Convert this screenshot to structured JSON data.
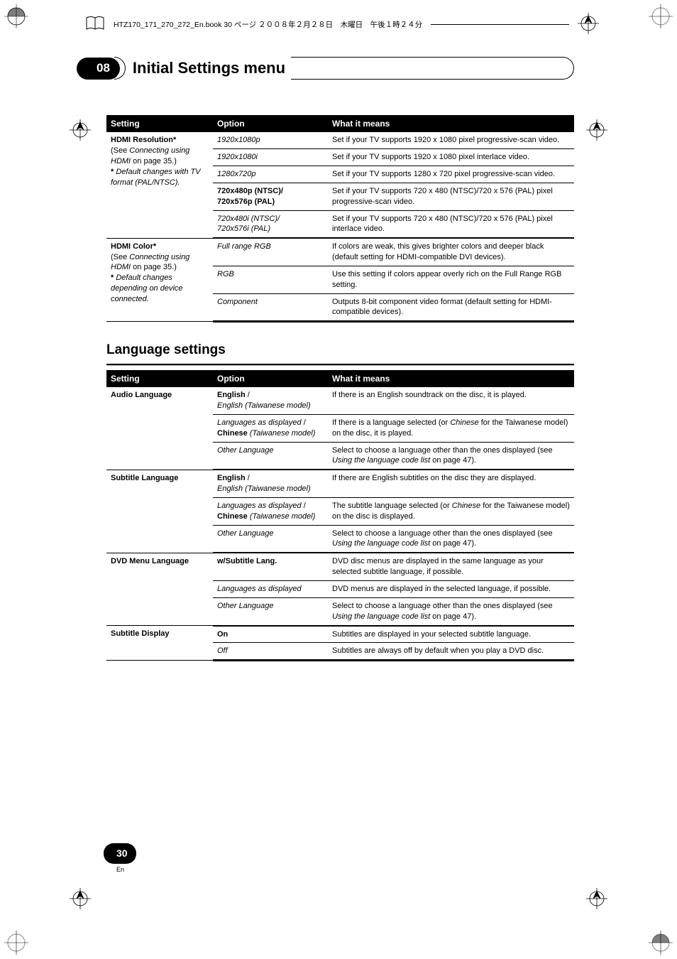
{
  "printerLine": "HTZ170_171_270_272_En.book  30 ページ  ２００８年２月２８日　木曜日　午後１時２４分",
  "chapter": {
    "number": "08",
    "title": "Initial Settings menu"
  },
  "table1": {
    "headers": [
      "Setting",
      "Option",
      "What it means"
    ],
    "groups": [
      {
        "setting_html": "<span class='bold'>HDMI Resolution*</span><br>(See <span class='ital'>Connecting using HDMI</span> on page 35.)<br><span class='bold'>*</span> <span class='ital'>Default changes with TV format (PAL/NTSC).</span>",
        "rows": [
          {
            "option_html": "<span class='ital'>1920x1080p</span>",
            "meaning": "Set if your TV supports 1920 x 1080 pixel progressive-scan video."
          },
          {
            "option_html": "<span class='ital'>1920x1080i</span>",
            "meaning": "Set if your TV supports 1920 x 1080 pixel interlace video."
          },
          {
            "option_html": "<span class='ital'>1280x720p</span>",
            "meaning": "Set if your TV supports 1280 x 720 pixel progressive-scan video."
          },
          {
            "option_html": "<span class='bold'>720x480p (NTSC)/<br>720x576p (PAL)</span>",
            "meaning": "Set if your TV supports 720 x 480 (NTSC)/720 x 576 (PAL) pixel progressive-scan video."
          },
          {
            "option_html": "<span class='ital'>720x480i (NTSC)/<br>720x576i (PAL)</span>",
            "meaning": "Set if your TV supports 720 x 480 (NTSC)/720 x 576 (PAL) pixel interlace video."
          }
        ]
      },
      {
        "setting_html": "<span class='bold'>HDMI Color*</span><br>(See <span class='ital'>Connecting using HDMI</span> on page 35.)<br><span class='bold'>*</span> <span class='ital'>Default changes depending on device connected.</span>",
        "rows": [
          {
            "option_html": "<span class='ital'>Full range RGB</span>",
            "meaning": "If colors are weak, this gives brighter colors and deeper black (default setting for HDMI-compatible DVI devices)."
          },
          {
            "option_html": "<span class='ital'>RGB</span>",
            "meaning": "Use this setting if colors appear overly rich on the Full Range RGB setting."
          },
          {
            "option_html": "<span class='ital'>Component</span>",
            "meaning": "Outputs 8-bit component video format (default setting for HDMI-compatible devices)."
          }
        ]
      }
    ]
  },
  "section2Title": "Language settings",
  "table2": {
    "headers": [
      "Setting",
      "Option",
      "What it means"
    ],
    "groups": [
      {
        "setting_html": "<span class='bold'>Audio Language</span>",
        "rows": [
          {
            "option_html": "<span class='bold'>English</span> /<br><span class='ital'>English (Taiwanese model)</span>",
            "meaning": "If there is an English soundtrack on the disc, it is played."
          },
          {
            "option_html": "<span class='ital'>Languages as displayed</span> /<br><span class='bold'>Chinese</span> <span class='ital'>(Taiwanese model)</span>",
            "meaning_html": "If there is a language selected (or <span class='ital'>Chinese</span> for the Taiwanese model) on the disc, it is played."
          },
          {
            "option_html": "<span class='ital'>Other Language</span>",
            "meaning_html": "Select to choose a language other than the ones displayed (see <span class='ital'>Using the language code list</span> on page 47)."
          }
        ]
      },
      {
        "setting_html": "<span class='bold'>Subtitle Language</span>",
        "rows": [
          {
            "option_html": "<span class='bold'>English</span> /<br><span class='ital'>English (Taiwanese model)</span>",
            "meaning": "If there are English subtitles on the disc they are displayed."
          },
          {
            "option_html": "<span class='ital'>Languages as displayed</span> /<br><span class='bold'>Chinese</span> <span class='ital'>(Taiwanese model)</span>",
            "meaning_html": "The subtitle language selected (or <span class='ital'>Chinese</span> for the Taiwanese model) on the disc is displayed."
          },
          {
            "option_html": "<span class='ital'>Other Language</span>",
            "meaning_html": "Select to choose a language other than the ones displayed (see <span class='ital'>Using the language code list</span> on page 47)."
          }
        ]
      },
      {
        "setting_html": "<span class='bold'>DVD Menu Language</span>",
        "rows": [
          {
            "option_html": "<span class='bold'>w/Subtitle Lang.</span>",
            "meaning": "DVD disc menus are displayed in the same language as your selected subtitle language, if possible."
          },
          {
            "option_html": "<span class='ital'>Languages as displayed</span>",
            "meaning": "DVD menus are displayed in the selected language, if possible."
          },
          {
            "option_html": "<span class='ital'>Other Language</span>",
            "meaning_html": "Select to choose a language other than the ones displayed (see <span class='ital'>Using the language code list</span> on page 47)."
          }
        ]
      },
      {
        "setting_html": "<span class='bold'>Subtitle Display</span>",
        "rows": [
          {
            "option_html": "<span class='bold'>On</span>",
            "meaning": "Subtitles are displayed in your selected subtitle language."
          },
          {
            "option_html": "<span class='ital'>Off</span>",
            "meaning": "Subtitles are always off by default when you play a DVD disc."
          }
        ]
      }
    ]
  },
  "pageNumber": "30",
  "pageLang": "En"
}
